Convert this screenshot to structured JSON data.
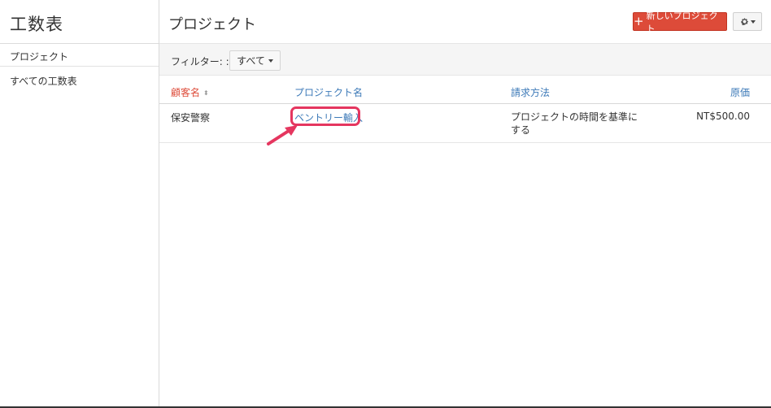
{
  "sidebar": {
    "title": "工数表",
    "items": [
      {
        "label": "プロジェクト"
      },
      {
        "label": "すべての工数表"
      }
    ]
  },
  "header": {
    "title": "プロジェクト",
    "new_button_label": "新しいプロジェクト",
    "new_button_icon": "plus-icon",
    "settings_icon": "gear-icon"
  },
  "filter": {
    "label": "フィルター: :",
    "selected": "すべて"
  },
  "table": {
    "columns": [
      {
        "label": "顧客名",
        "sorted": true
      },
      {
        "label": "プロジェクト名"
      },
      {
        "label": "請求方法"
      },
      {
        "label": "原価"
      }
    ],
    "rows": [
      {
        "client": "保安警察",
        "project": "ベントリー輸入",
        "billing": "プロジェクトの時間を基準にする",
        "cost": "NT$500.00"
      }
    ]
  },
  "colors": {
    "accent_red": "#dd4b39",
    "link_blue": "#3d7ab8",
    "highlight_pink": "#e5365f"
  }
}
